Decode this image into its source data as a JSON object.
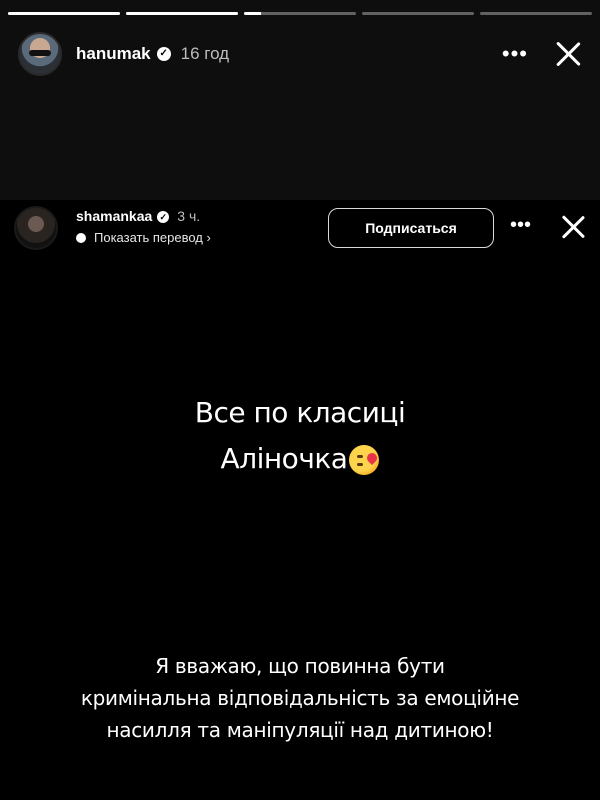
{
  "outer_story": {
    "username": "hanumak",
    "time": "16 год",
    "progress": [
      1,
      1,
      0.15,
      0,
      0
    ]
  },
  "inner_story": {
    "username": "shamankaa",
    "time": "3 ч.",
    "translate_label": "Показать перевод",
    "follow_label": "Подписаться"
  },
  "caption": {
    "line1": "Все по класиці",
    "line2": "Аліночка"
  },
  "bottom_text": {
    "line1": "Я вважаю, що повинна бути",
    "line2": "кримінальна відповідальність за емоційне",
    "line3": "насилля та маніпуляції над дитиною!"
  },
  "icons": {
    "more": "more-icon",
    "close": "close-icon",
    "verified": "verified-icon",
    "emoji": "kissing-face-icon"
  }
}
